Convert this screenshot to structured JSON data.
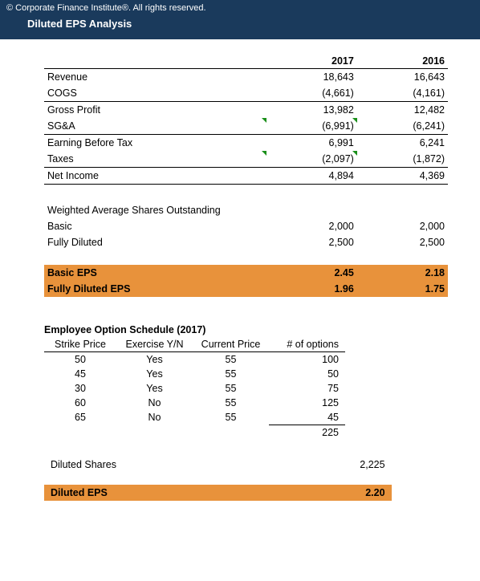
{
  "header": {
    "copyright": "© Corporate Finance Institute®. All rights reserved.",
    "title": "Diluted EPS Analysis"
  },
  "years": {
    "y1": "2017",
    "y2": "2016"
  },
  "income": {
    "revenue": {
      "label": "Revenue",
      "y1": "18,643",
      "y2": "16,643"
    },
    "cogs": {
      "label": "COGS",
      "y1": "(4,661)",
      "y2": "(4,161)"
    },
    "gross_profit": {
      "label": "Gross Profit",
      "y1": "13,982",
      "y2": "12,482"
    },
    "sga": {
      "label": "SG&A",
      "y1": "(6,991)",
      "y2": "(6,241)"
    },
    "ebt": {
      "label": "Earning Before  Tax",
      "y1": "6,991",
      "y2": "6,241"
    },
    "taxes": {
      "label": "Taxes",
      "y1": "(2,097)",
      "y2": "(1,872)"
    },
    "net_income": {
      "label": "Net Income",
      "y1": "4,894",
      "y2": "4,369"
    }
  },
  "shares": {
    "title": "Weighted Average Shares Outstanding",
    "basic": {
      "label": "Basic",
      "y1": "2,000",
      "y2": "2,000"
    },
    "diluted": {
      "label": "Fully Diluted",
      "y1": "2,500",
      "y2": "2,500"
    }
  },
  "eps": {
    "basic": {
      "label": "Basic EPS",
      "y1": "2.45",
      "y2": "2.18"
    },
    "fully": {
      "label": "Fully Diluted EPS",
      "y1": "1.96",
      "y2": "1.75"
    }
  },
  "options": {
    "title": "Employee Option Schedule (2017)",
    "headers": {
      "strike": "Strike Price",
      "exercise": "Exercise Y/N",
      "current": "Current Price",
      "count": "# of options"
    },
    "rows": [
      {
        "strike": "50",
        "ex": "Yes",
        "curr": "55",
        "cnt": "100"
      },
      {
        "strike": "45",
        "ex": "Yes",
        "curr": "55",
        "cnt": "50"
      },
      {
        "strike": "30",
        "ex": "Yes",
        "curr": "55",
        "cnt": "75"
      },
      {
        "strike": "60",
        "ex": "No",
        "curr": "55",
        "cnt": "125"
      },
      {
        "strike": "65",
        "ex": "No",
        "curr": "55",
        "cnt": "45"
      }
    ],
    "sum": "225"
  },
  "diluted_shares": {
    "label": "Diluted Shares",
    "value": "2,225"
  },
  "diluted_eps": {
    "label": "Diluted EPS",
    "value": "2.20"
  },
  "chart_data": {
    "type": "table",
    "title": "Diluted EPS Analysis",
    "income_statement": {
      "columns": [
        "2017",
        "2016"
      ],
      "rows": [
        {
          "label": "Revenue",
          "v": [
            18643,
            16643
          ]
        },
        {
          "label": "COGS",
          "v": [
            -4661,
            -4161
          ]
        },
        {
          "label": "Gross Profit",
          "v": [
            13982,
            12482
          ]
        },
        {
          "label": "SG&A",
          "v": [
            -6991,
            -6241
          ]
        },
        {
          "label": "Earning Before Tax",
          "v": [
            6991,
            6241
          ]
        },
        {
          "label": "Taxes",
          "v": [
            -2097,
            -1872
          ]
        },
        {
          "label": "Net Income",
          "v": [
            4894,
            4369
          ]
        }
      ]
    },
    "shares": {
      "Basic": [
        2000,
        2000
      ],
      "Fully Diluted": [
        2500,
        2500
      ]
    },
    "eps": {
      "Basic EPS": [
        2.45,
        2.18
      ],
      "Fully Diluted EPS": [
        1.96,
        1.75
      ]
    },
    "option_schedule_2017": [
      {
        "strike": 50,
        "exercise": "Yes",
        "current": 55,
        "options": 100
      },
      {
        "strike": 45,
        "exercise": "Yes",
        "current": 55,
        "options": 50
      },
      {
        "strike": 30,
        "exercise": "Yes",
        "current": 55,
        "options": 75
      },
      {
        "strike": 60,
        "exercise": "No",
        "current": 55,
        "options": 125
      },
      {
        "strike": 65,
        "exercise": "No",
        "current": 55,
        "options": 45
      }
    ],
    "option_schedule_total": 225,
    "diluted_shares": 2225,
    "diluted_eps": 2.2
  }
}
